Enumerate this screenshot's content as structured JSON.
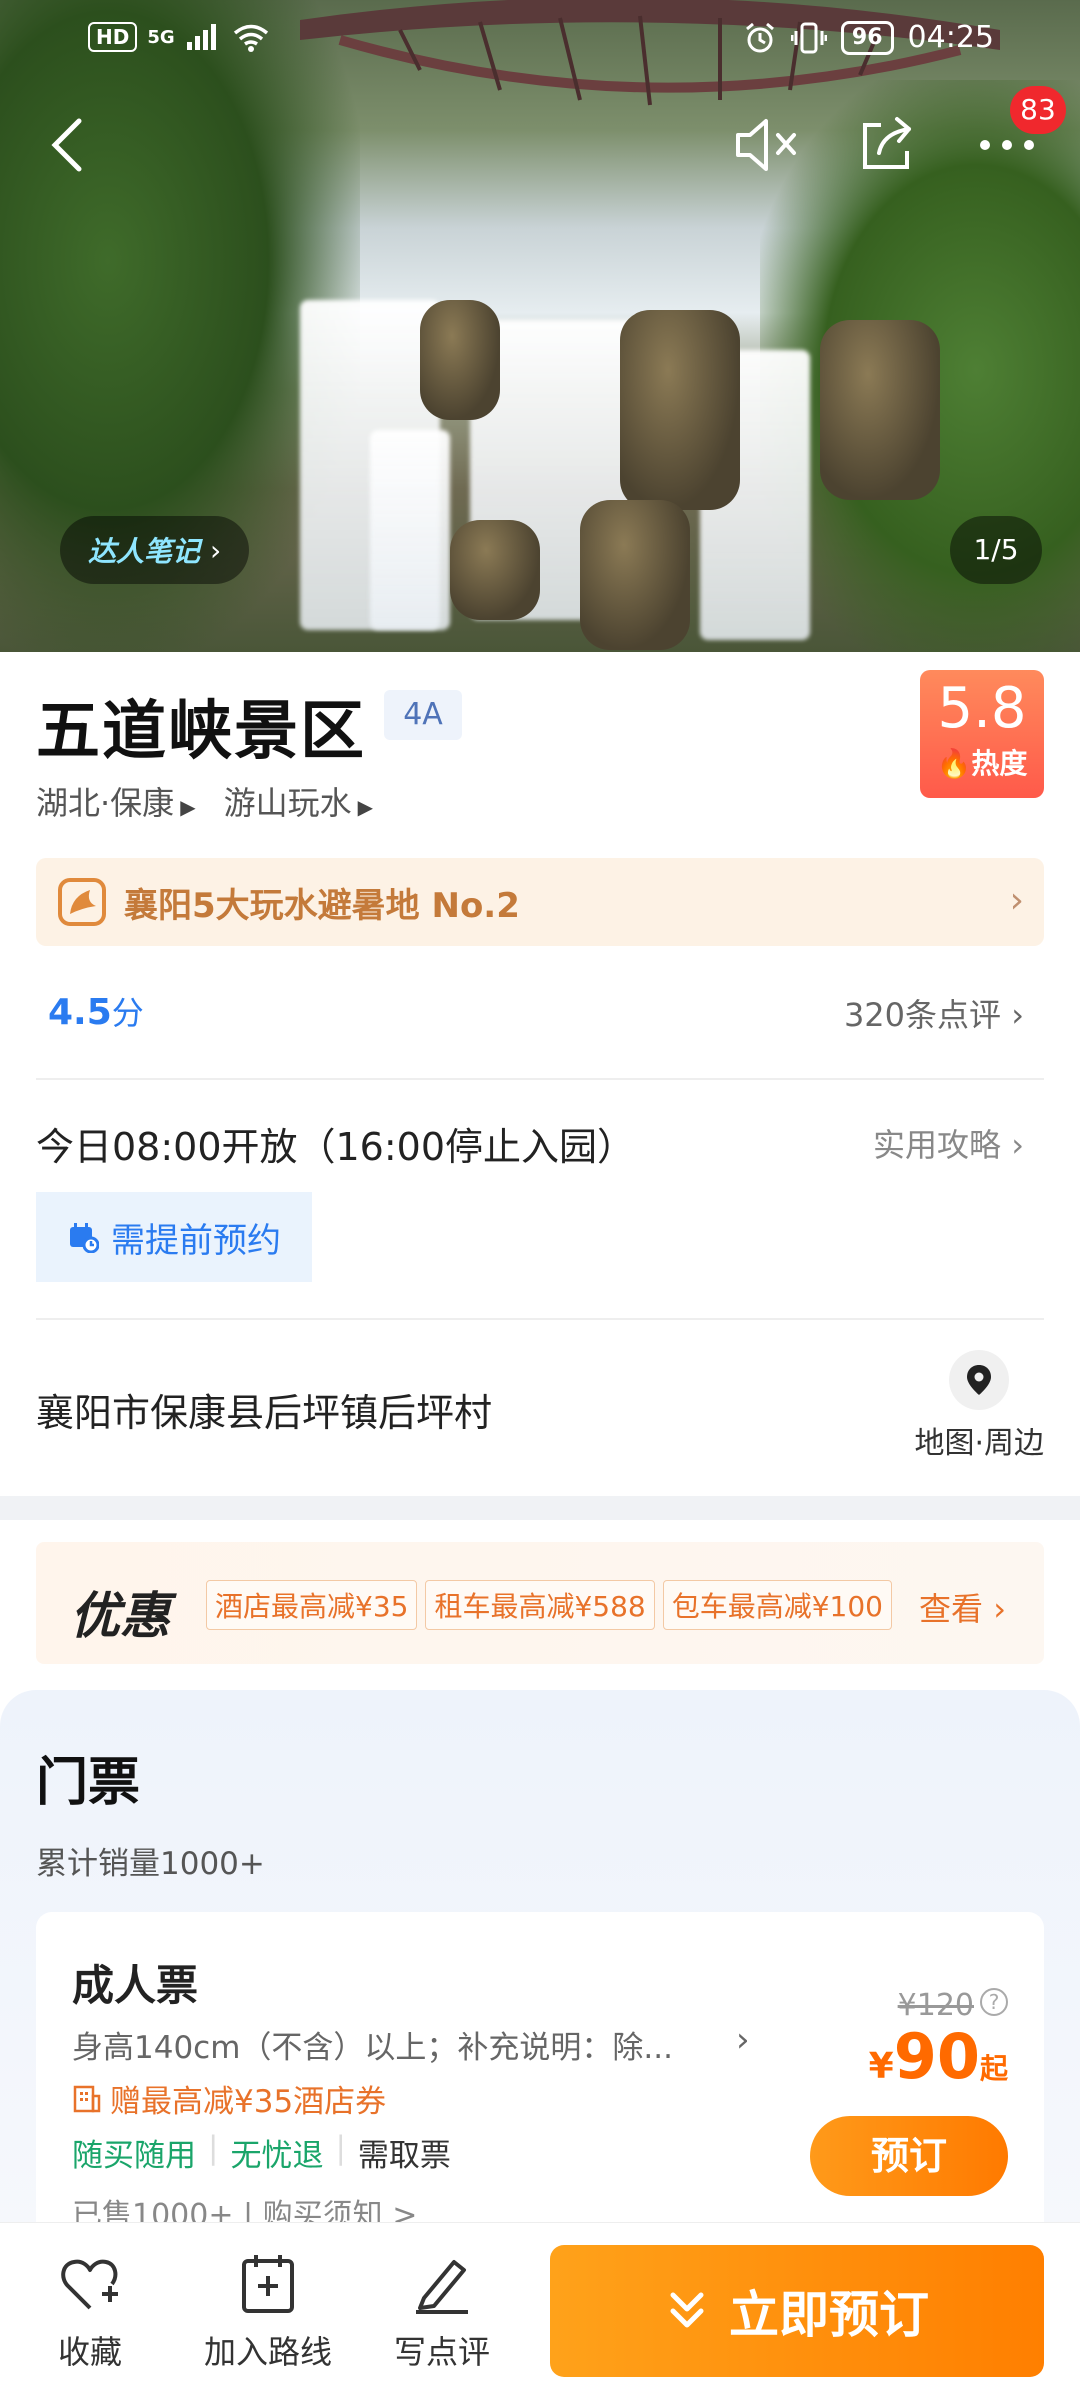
{
  "status_bar": {
    "left_chips": [
      "HD",
      "5G"
    ],
    "battery": "96",
    "time": "04:25"
  },
  "nav": {
    "notification_count": "83"
  },
  "hero": {
    "notes_label": "达人笔记",
    "photo_counter": "1/5"
  },
  "attraction": {
    "name": "五道峡景区",
    "level": "4A",
    "heat_value": "5.8",
    "heat_label": "热度",
    "region": "湖北·保康",
    "category": "游山玩水",
    "rank_text": "襄阳5大玩水避暑地 No.2"
  },
  "rating": {
    "score": "4.5",
    "unit": "分",
    "reviews": "320条点评"
  },
  "hours": {
    "text": "今日08:00开放（16:00停止入园）",
    "guide": "实用攻略",
    "reservation": "需提前预约"
  },
  "location": {
    "address": "襄阳市保康县后坪镇后坪村",
    "map_label": "地图·周边"
  },
  "promo": {
    "title": "优惠",
    "chips": [
      "酒店最高减¥35",
      "租车最高减¥588",
      "包车最高减¥100"
    ],
    "see": "查看"
  },
  "tickets": {
    "title": "门票",
    "sales": "累计销量1000+",
    "card": {
      "name": "成人票",
      "desc": "身高140cm（不含）以上；补充说明：除...",
      "hotel": "赠最高减¥35酒店券",
      "features": [
        "随买随用",
        "无忧退",
        "需取票"
      ],
      "sold": "已售1000+ | 购买须知 >",
      "orig_price": "¥120",
      "currency": "¥",
      "price": "90",
      "from": "起",
      "book": "预订"
    }
  },
  "bottom": {
    "favorite": "收藏",
    "add_route": "加入路线",
    "write_review": "写点评",
    "cta": "立即预订"
  },
  "colors": {
    "accent_orange": "#ff7f00",
    "score_blue": "#2a7bf0",
    "heat_red": "#ff5a4a",
    "feature_green": "#1aa56a"
  }
}
